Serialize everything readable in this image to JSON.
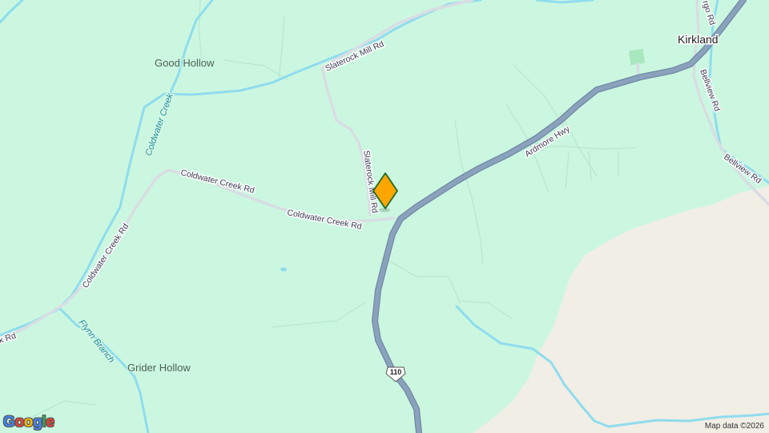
{
  "map": {
    "colors": {
      "land": "#cbf7e0",
      "developed_land": "#f1eee6",
      "highway": "#8ba2bd",
      "highway_casing": "#6f88a6",
      "local_road": "#d9dde3",
      "water": "#8fdcee",
      "marker_fill": "#ffa500",
      "marker_border": "#1e6b2a"
    },
    "labels": {
      "good_hollow": "Good Hollow",
      "grider_hollow": "Grider Hollow",
      "kirkland": "Kirkland",
      "coldwater_creek_water": "Coldwater Creek",
      "flynn_branch": "Flynn Branch",
      "slaterock_mill_rd_top": "Slaterock Mill Rd",
      "slaterock_mill_rd_vertical": "Slaterock Mill Rd",
      "coldwater_creek_rd_upper": "Coldwater Creek Rd",
      "coldwater_creek_rd_lower": "Coldwater Creek Rd",
      "coldwater_creek_rd_diagonal": "Coldwater Creek Rd",
      "ardmore_hwy": "Ardmore Hwy",
      "bellview_rd_upper": "Bellview Rd",
      "bellview_rd_lower": "Bellview Rd",
      "rd_left_edge": "k Rd",
      "rgo_rd_top": "rgo Rd"
    },
    "route_shield": "110",
    "marker": {
      "icon": "location-pin-icon"
    },
    "attribution": "Map data ©2026",
    "logo_letters": [
      {
        "char": "G",
        "color": "#4285f4"
      },
      {
        "char": "o",
        "color": "#ea4335"
      },
      {
        "char": "o",
        "color": "#fbbc05"
      },
      {
        "char": "g",
        "color": "#4285f4"
      },
      {
        "char": "l",
        "color": "#34a853"
      },
      {
        "char": "e",
        "color": "#ea4335"
      }
    ]
  }
}
